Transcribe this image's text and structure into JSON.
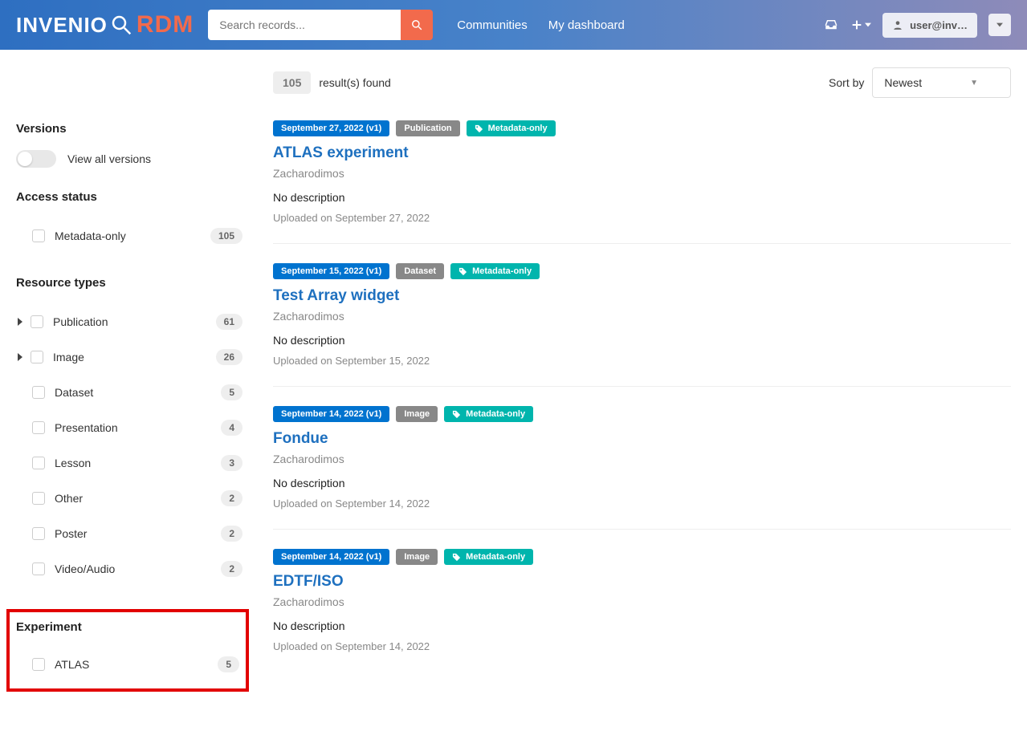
{
  "header": {
    "logo_invenio": "INVENIO",
    "logo_rdm": "RDM",
    "search_placeholder": "Search records...",
    "nav": {
      "communities": "Communities",
      "dashboard": "My dashboard"
    },
    "user": "user@inv…"
  },
  "results": {
    "count": "105",
    "label": "result(s) found",
    "sort_label": "Sort by",
    "sort_value": "Newest"
  },
  "facets": {
    "versions": {
      "title": "Versions",
      "toggle_label": "View all versions"
    },
    "access": {
      "title": "Access status",
      "items": [
        {
          "label": "Metadata-only",
          "count": "105"
        }
      ]
    },
    "resource": {
      "title": "Resource types",
      "items": [
        {
          "label": "Publication",
          "count": "61",
          "expandable": true
        },
        {
          "label": "Image",
          "count": "26",
          "expandable": true
        },
        {
          "label": "Dataset",
          "count": "5"
        },
        {
          "label": "Presentation",
          "count": "4"
        },
        {
          "label": "Lesson",
          "count": "3"
        },
        {
          "label": "Other",
          "count": "2"
        },
        {
          "label": "Poster",
          "count": "2"
        },
        {
          "label": "Video/Audio",
          "count": "2"
        }
      ]
    },
    "experiment": {
      "title": "Experiment",
      "items": [
        {
          "label": "ATLAS",
          "count": "5"
        }
      ]
    }
  },
  "records": [
    {
      "date": "September 27, 2022 (v1)",
      "type": "Publication",
      "access": "Metadata-only",
      "title": "ATLAS experiment",
      "author": "Zacharodimos",
      "desc": "No description",
      "uploaded": "Uploaded on September 27, 2022"
    },
    {
      "date": "September 15, 2022 (v1)",
      "type": "Dataset",
      "access": "Metadata-only",
      "title": "Test Array widget",
      "author": "Zacharodimos",
      "desc": "No description",
      "uploaded": "Uploaded on September 15, 2022"
    },
    {
      "date": "September 14, 2022 (v1)",
      "type": "Image",
      "access": "Metadata-only",
      "title": "Fondue",
      "author": "Zacharodimos",
      "desc": "No description",
      "uploaded": "Uploaded on September 14, 2022"
    },
    {
      "date": "September 14, 2022 (v1)",
      "type": "Image",
      "access": "Metadata-only",
      "title": "EDTF/ISO",
      "author": "Zacharodimos",
      "desc": "No description",
      "uploaded": "Uploaded on September 14, 2022"
    }
  ]
}
